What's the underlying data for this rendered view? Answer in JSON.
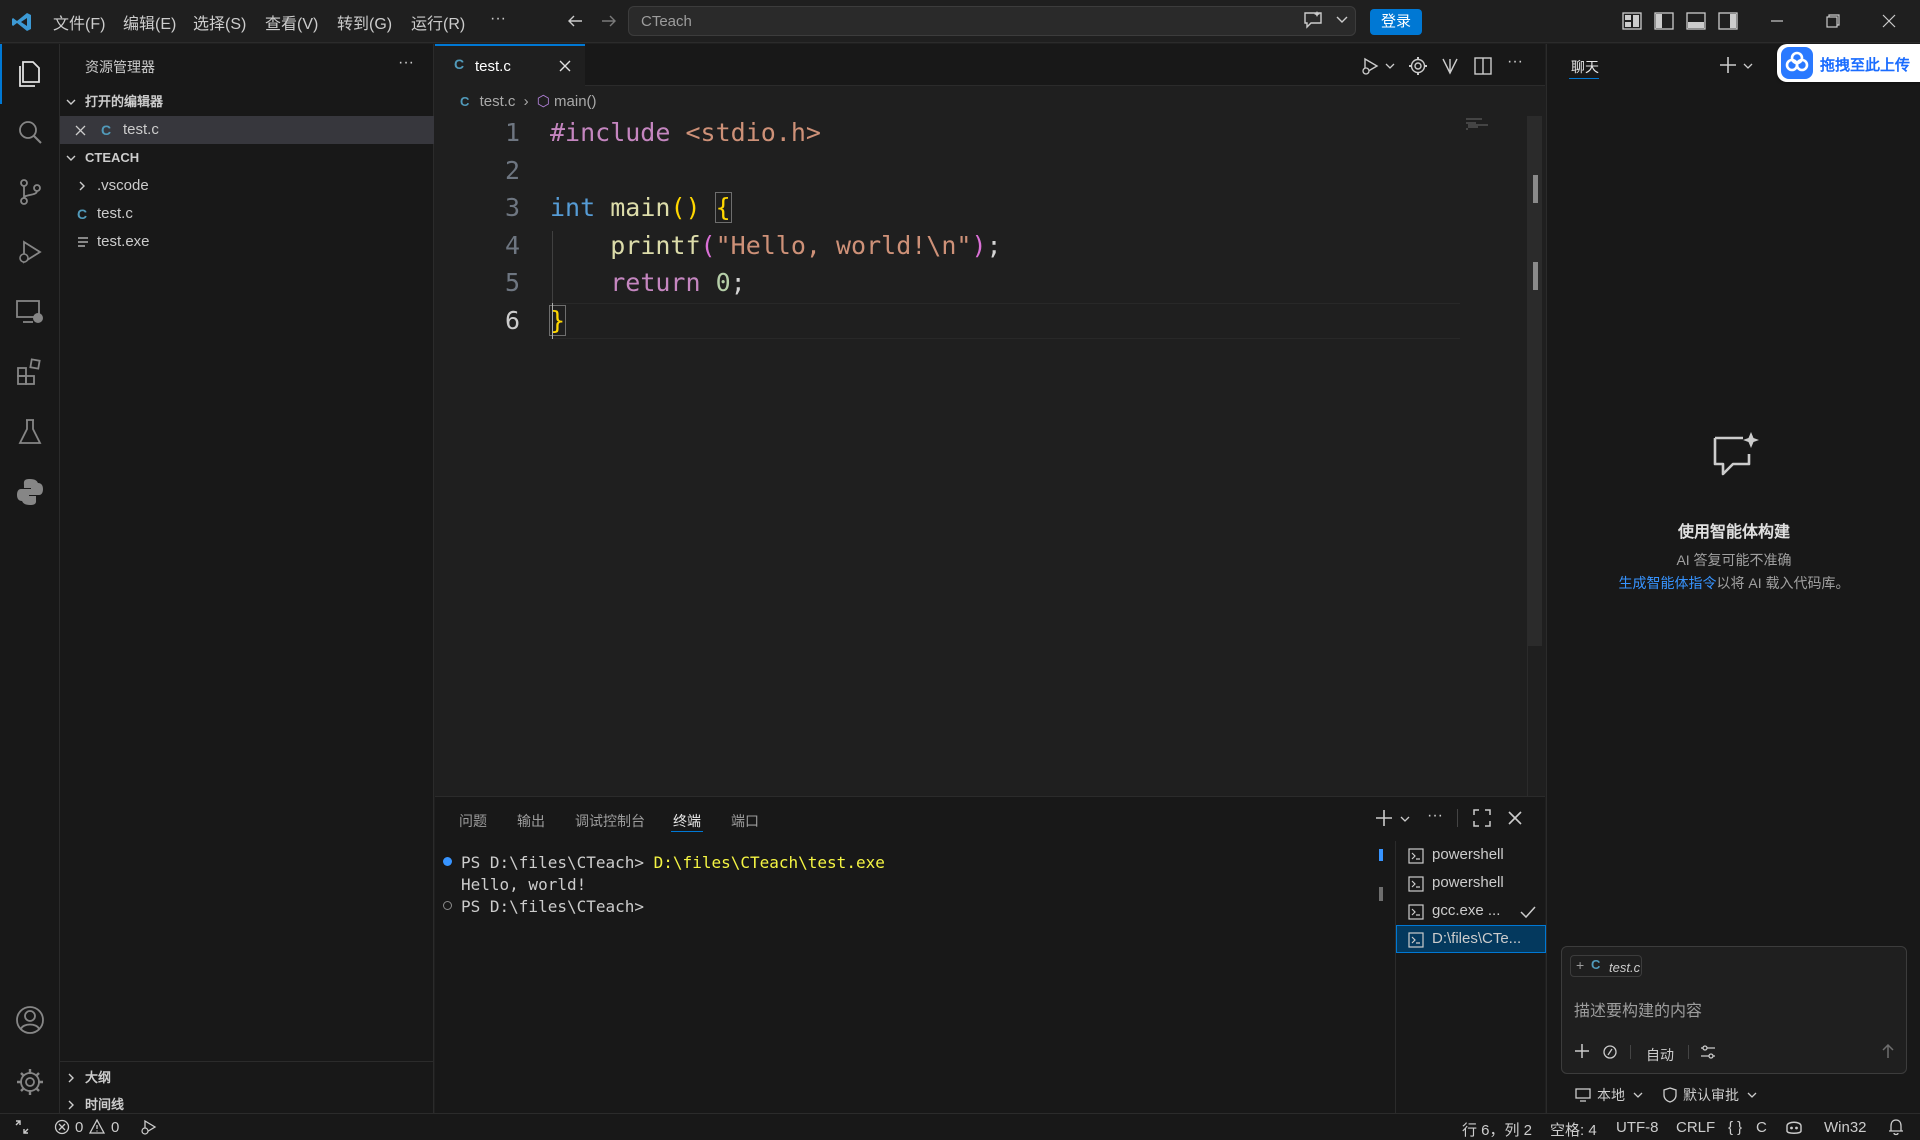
{
  "menu": [
    "文件(F)",
    "编辑(E)",
    "选择(S)",
    "查看(V)",
    "转到(G)",
    "运行(R)",
    "···"
  ],
  "command_center": {
    "placeholder": "CTeach"
  },
  "login_label": "登录",
  "sidebar": {
    "title": "资源管理器",
    "more": "···",
    "open_editors": {
      "label": "打开的编辑器",
      "items": [
        "test.c"
      ]
    },
    "folder": {
      "label": "CTEACH",
      "items": [
        ".vscode",
        "test.c",
        "test.exe"
      ]
    },
    "outline_label": "大纲",
    "timeline_label": "时间线"
  },
  "editor": {
    "tab_label": "test.c",
    "breadcrumb": {
      "file": "test.c",
      "symbol": "main()"
    },
    "lines": [
      "1",
      "2",
      "3",
      "4",
      "5",
      "6"
    ]
  },
  "panel": {
    "tabs": [
      "问题",
      "输出",
      "调试控制台",
      "终端",
      "端口"
    ],
    "active_tab": "终端",
    "terminal": {
      "line1_prompt": "PS D:\\files\\CTeach> ",
      "line1_cmd": "D:\\files\\CTeach\\test.exe",
      "line2": "Hello, world!",
      "line3": "PS D:\\files\\CTeach>"
    },
    "terminals": [
      "powershell",
      "powershell",
      "gcc.exe ...",
      "D:\\files\\CTe..."
    ]
  },
  "chat": {
    "tab_label": "聊天",
    "baidu_badge": "拖拽至此上传",
    "heading": "使用智能体构建",
    "subtext": "AI 答复可能不准确",
    "link_text": "生成智能体指令",
    "link_suffix": "以将 AI 载入代码库。",
    "context_chip": "test.c",
    "input_placeholder": "描述要构建的内容",
    "mode_label": "自动",
    "local_label": "本地",
    "approval_label": "默认审批"
  },
  "status": {
    "errors": "0",
    "warnings": "0",
    "position": "行 6，列 2",
    "spaces": "空格: 4",
    "encoding": "UTF-8",
    "eol": "CRLF",
    "language": "C",
    "platform": "Win32"
  },
  "colors": {
    "accent": "#0078d4",
    "background": "#1f1f1f",
    "sidebar": "#181818"
  }
}
